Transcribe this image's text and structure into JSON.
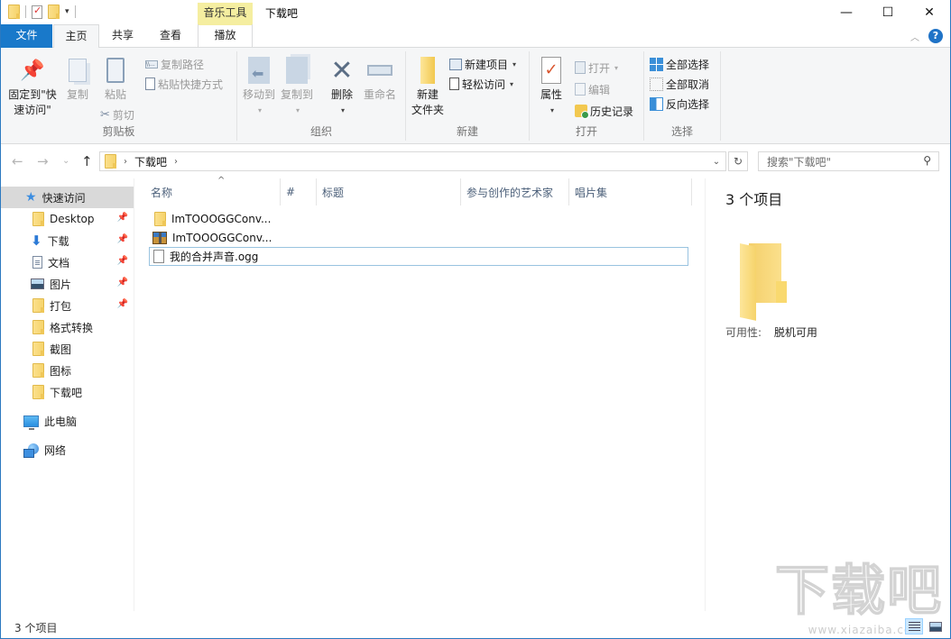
{
  "window": {
    "title": "下载吧",
    "contextual_tab_group": "音乐工具",
    "controls": {
      "minimize": "—",
      "maximize": "☐",
      "close": "✕"
    }
  },
  "quick_access_toolbar": {
    "items": [
      "folder-icon",
      "properties-icon",
      "new-folder-icon",
      "customize-dropdown"
    ]
  },
  "ribbon_tabs": [
    {
      "label": "文件",
      "active": false,
      "style": "file"
    },
    {
      "label": "主页",
      "active": true
    },
    {
      "label": "共享",
      "active": false
    },
    {
      "label": "查看",
      "active": false
    },
    {
      "label": "播放",
      "active": false,
      "contextual": true
    }
  ],
  "ribbon": {
    "clipboard": {
      "label": "剪贴板",
      "pin": "固定到\"快\n速访问\"",
      "pin_line1": "固定到\"快",
      "pin_line2": "速访问\"",
      "copy": "复制",
      "paste": "粘贴",
      "copy_path": "复制路径",
      "paste_shortcut": "粘贴快捷方式",
      "cut": "剪切"
    },
    "organize": {
      "label": "组织",
      "move_to": "移动到",
      "copy_to": "复制到",
      "delete": "删除",
      "rename": "重命名"
    },
    "new": {
      "label": "新建",
      "new_folder_line1": "新建",
      "new_folder_line2": "文件夹",
      "new_item": "新建项目",
      "easy_access": "轻松访问"
    },
    "open": {
      "label": "打开",
      "properties": "属性",
      "open": "打开",
      "edit": "编辑",
      "history": "历史记录"
    },
    "select": {
      "label": "选择",
      "select_all": "全部选择",
      "select_none": "全部取消",
      "invert": "反向选择"
    }
  },
  "navigation": {
    "back": "←",
    "forward": "→",
    "recent": "⌄",
    "up": "↑",
    "breadcrumb": [
      "下载吧"
    ],
    "search_placeholder": "搜索\"下载吧\""
  },
  "sidebar": {
    "quick_access": "快速访问",
    "items": [
      {
        "label": "Desktop",
        "icon": "folder",
        "pinned": true
      },
      {
        "label": "下载",
        "icon": "download",
        "pinned": true
      },
      {
        "label": "文档",
        "icon": "document",
        "pinned": true
      },
      {
        "label": "图片",
        "icon": "pictures",
        "pinned": true
      },
      {
        "label": "打包",
        "icon": "folder",
        "pinned": true
      },
      {
        "label": "格式转换",
        "icon": "folder",
        "pinned": false
      },
      {
        "label": "截图",
        "icon": "folder",
        "pinned": false
      },
      {
        "label": "图标",
        "icon": "folder",
        "pinned": false
      },
      {
        "label": "下载吧",
        "icon": "folder",
        "pinned": false
      }
    ],
    "this_pc": "此电脑",
    "network": "网络"
  },
  "file_list": {
    "columns": [
      "名称",
      "#",
      "标题",
      "参与创作的艺术家",
      "唱片集"
    ],
    "sorted_by": "名称",
    "files": [
      {
        "name": "ImTOOOGGConv...",
        "type": "folder"
      },
      {
        "name": "ImTOOOGGConv...",
        "type": "archive"
      },
      {
        "name": "我的合并声音.ogg",
        "type": "file",
        "focused": true
      }
    ]
  },
  "preview": {
    "title": "3 个项目",
    "availability_label": "可用性:",
    "availability_value": "脱机可用"
  },
  "status_bar": {
    "item_count": "3 个项目",
    "view_mode": "details"
  },
  "watermark": {
    "text": "下载吧",
    "url": "www.xiazaiba.com"
  }
}
